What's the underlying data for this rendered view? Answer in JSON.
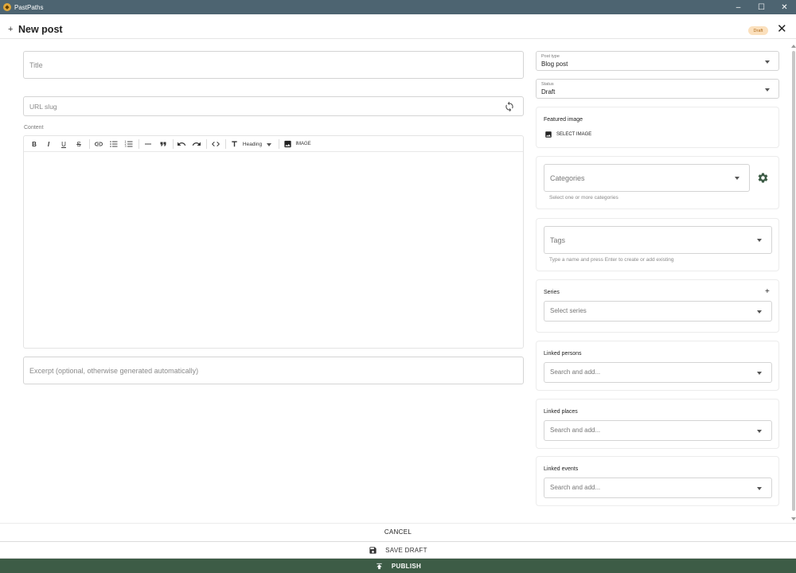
{
  "window": {
    "app_name": "PastPaths",
    "controls": {
      "minimize": "–",
      "maximize": "☐",
      "close": "✕"
    }
  },
  "header": {
    "plus": "+",
    "title": "New post",
    "status_badge": "Draft",
    "close": "✕"
  },
  "main": {
    "title_placeholder": "Title",
    "slug_placeholder": "URL slug",
    "content_label": "Content",
    "excerpt_placeholder": "Excerpt (optional, otherwise generated automatically)",
    "toolbar": {
      "bold": "B",
      "italic": "I",
      "underline": "U",
      "strike": "S",
      "heading_label": "Heading",
      "image_label": "IMAGE"
    }
  },
  "sidebar": {
    "post_type": {
      "label": "Post type",
      "value": "Blog post"
    },
    "status": {
      "label": "Status",
      "value": "Draft"
    },
    "featured_image": {
      "label": "Featured image",
      "button": "SELECT IMAGE"
    },
    "categories": {
      "placeholder": "Categories",
      "hint": "Select one or more categories"
    },
    "tags": {
      "placeholder": "Tags",
      "hint": "Type a name and press Enter to create or add existing"
    },
    "series": {
      "label": "Series",
      "add": "+",
      "placeholder": "Select series"
    },
    "linked_persons": {
      "label": "Linked persons",
      "placeholder": "Search and add..."
    },
    "linked_places": {
      "label": "Linked places",
      "placeholder": "Search and add..."
    },
    "linked_events": {
      "label": "Linked events",
      "placeholder": "Search and add..."
    }
  },
  "footer": {
    "cancel": "CANCEL",
    "save_draft": "SAVE DRAFT",
    "publish": "PUBLISH"
  },
  "colors": {
    "titlebar": "#4d6471",
    "publish": "#3d5c46",
    "badge_bg": "#fbe0bd",
    "badge_text": "#b06b1a"
  }
}
